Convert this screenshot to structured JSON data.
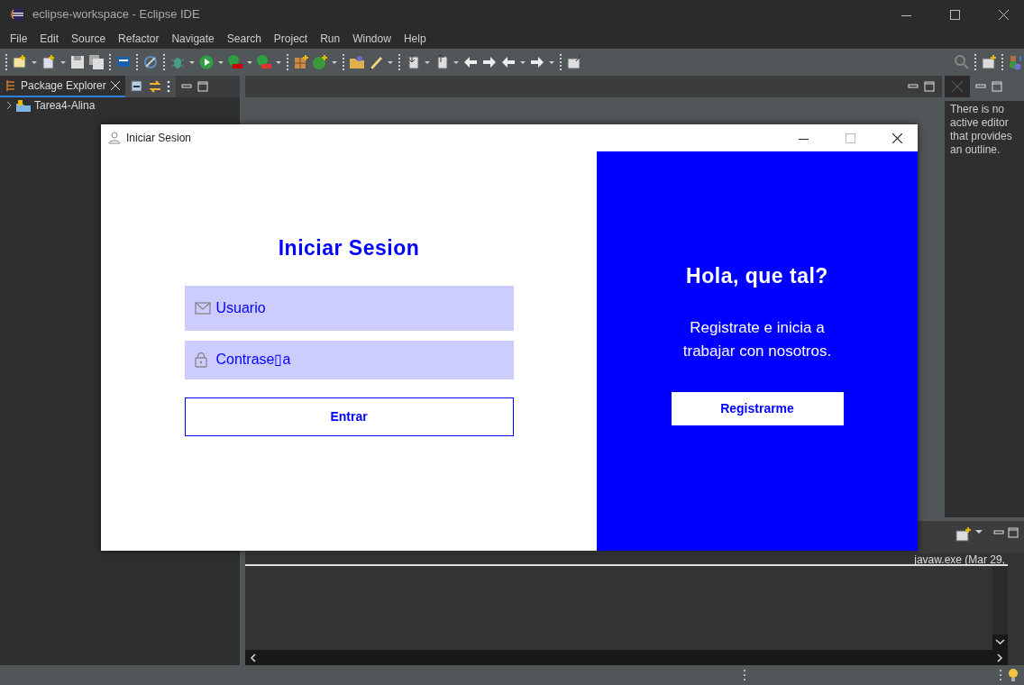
{
  "window": {
    "title": "eclipse-workspace - Eclipse IDE"
  },
  "menu": [
    "File",
    "Edit",
    "Source",
    "Refactor",
    "Navigate",
    "Search",
    "Project",
    "Run",
    "Window",
    "Help"
  ],
  "package_explorer": {
    "tab": {
      "label": "Package Explorer",
      "selected": true
    },
    "tree": [
      {
        "label": "Tarea4-Alina",
        "expanded": false
      }
    ]
  },
  "outline": {
    "message": "There is no active editor that provides an outline."
  },
  "console": {
    "header": "javaw.exe  (Mar 29,"
  },
  "dialog": {
    "title": "Iniciar Sesion",
    "heading": "Iniciar Sesion",
    "fields": [
      {
        "kind": "email",
        "placeholder": "Usuario"
      },
      {
        "kind": "password",
        "placeholder": "Contrase▯a"
      }
    ],
    "submit": "Entrar",
    "panel": {
      "heading": "Hola, que tal?",
      "text": "Registrate e inicia a trabajar con nosotros.",
      "button": "Registrarme"
    }
  }
}
